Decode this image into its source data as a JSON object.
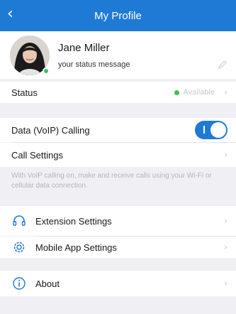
{
  "header": {
    "back_icon": "chevron-left-icon",
    "title": "My Profile"
  },
  "profile": {
    "name": "Jane Miller",
    "status_message": "your status message",
    "presence_color": "#3cc25a",
    "edit_icon": "pencil-icon"
  },
  "status_row": {
    "label": "Status",
    "value": "Available"
  },
  "voip_row": {
    "label": "Data (VoIP) Calling",
    "enabled": true
  },
  "call_settings": {
    "label": "Call Settings"
  },
  "voip_note": "With VoIP calling on, make and receive calls using your Wi-Fi or cellular data connection.",
  "extension_settings": {
    "label": "Extension Settings",
    "icon": "headset-icon"
  },
  "mobile_app_settings": {
    "label": "Mobile App Settings",
    "icon": "gear-icon"
  },
  "about": {
    "label": "About",
    "icon": "info-icon"
  },
  "colors": {
    "accent": "#1f7ad6",
    "background": "#efeff4"
  }
}
